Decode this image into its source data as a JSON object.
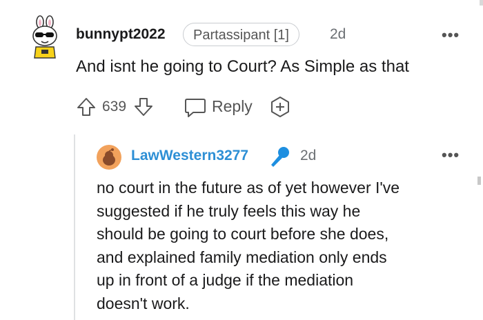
{
  "comment": {
    "username": "bunnypt2022",
    "flair": "Partassipant [1]",
    "age": "2d",
    "more": "•••",
    "body": "And isnt he going to Court? As Simple as that",
    "score": "639",
    "reply_label": "Reply"
  },
  "reply": {
    "username": "LawWestern3277",
    "age": "2d",
    "more": "•••",
    "body_lines": [
      "no court in the future as of yet however I've",
      "suggested if he truly feels this way he",
      "should be going to court before she does,",
      "and explained family mediation only ends",
      "up in front of a judge if the mediation",
      "doesn't work."
    ]
  },
  "icons": {
    "avatar1": "bunny-sunglasses-avatar",
    "upvote": "arrow-up-icon",
    "downvote": "arrow-down-icon",
    "reply": "speech-bubble-icon",
    "award": "plus-award-icon",
    "avatar2": "snoo-avatar",
    "op_badge": "microphone-icon"
  },
  "colors": {
    "username_reply": "#2d8fd5",
    "mic_blue": "#1e8fe0",
    "avatar2_bg": "#f2a25c"
  }
}
